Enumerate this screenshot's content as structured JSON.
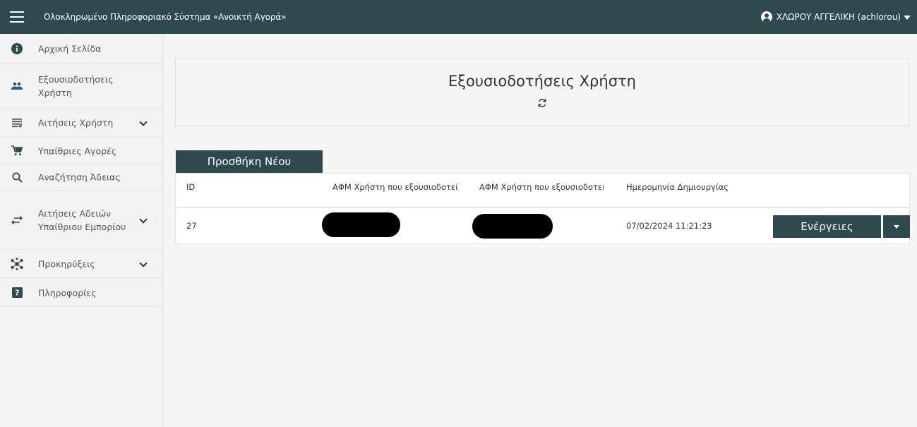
{
  "topbar": {
    "app_title": "Ολοκληρωμένο Πληροφοριακό Σύστημα «Ανοικτή Αγορά»",
    "user_name": "ΧΛΩΡΟΥ ΑΓΓΕΛΙΚΗ (achlorou)"
  },
  "sidebar": {
    "items": [
      {
        "label": "Αρχική Σελίδα",
        "icon": "info-icon"
      },
      {
        "label": "Εξουσιοδοτήσεις Χρήστη",
        "icon": "people-icon"
      },
      {
        "label": "Αιτήσεις Χρήστη",
        "icon": "list-icon",
        "expandable": true
      },
      {
        "label": "Υπαίθριες Αγορές",
        "icon": "cart-icon"
      },
      {
        "label": "Αναζήτηση Άδειας",
        "icon": "search-icon"
      },
      {
        "label": "Αιτήσεις Αδειών Υπαίθριου Εμπορίου",
        "icon": "swap-icon",
        "expandable": true
      },
      {
        "label": "Προκηρύξεις",
        "icon": "hub-icon",
        "expandable": true
      },
      {
        "label": "Πληροφορίες",
        "icon": "help-icon"
      }
    ]
  },
  "main": {
    "title": "Εξουσιοδοτήσεις Χρήστη",
    "add_button": "Προσθήκη Νέου",
    "table": {
      "headers": [
        "ID",
        "ΑΦΜ Χρήστη που εξουσιοδοτεί",
        "ΑΦΜ Χρήστη που εξουσιοδοτείται",
        "Ημερομηνία Δημιουργίας"
      ],
      "rows": [
        {
          "id": "27",
          "date": "07/02/2024 11:21:23",
          "actions_label": "Ενέργειες"
        }
      ]
    }
  },
  "colors": {
    "primary": "#2e4a4f",
    "background": "#f5f5f5"
  }
}
